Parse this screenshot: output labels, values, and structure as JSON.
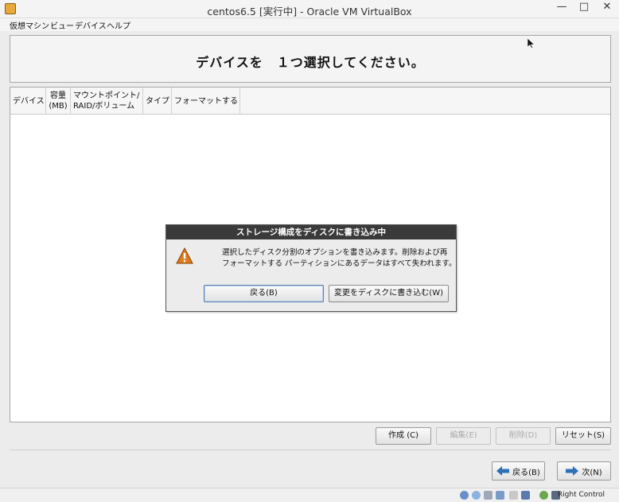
{
  "window": {
    "title": "centos6.5 [実行中] - Oracle VM VirtualBox",
    "min_glyph": "—",
    "max_glyph": "□",
    "close_glyph": "✕"
  },
  "menu": {
    "items": [
      "仮想マシン",
      "ビュー",
      "デバイス",
      "ヘルプ"
    ]
  },
  "header": {
    "title": "デバイスを　１つ選択してください。"
  },
  "table": {
    "columns": {
      "device": "デバイス",
      "size_1": "容量",
      "size_2": "(MB)",
      "mount_1": "マウントポイント/",
      "mount_2": "RAID/ボリューム",
      "type": "タイプ",
      "format": "フォーマットする"
    }
  },
  "dialog": {
    "title": "ストレージ構成をディスクに書き込み中",
    "message_line1": "選択したディスク分割のオプションを書き込みます。削除および再",
    "message_line2": "フォーマットする パーティションにあるデータはすべて失われます。",
    "back_label": "戻る(B)",
    "write_label": "変更をディスクに書き込む(W)"
  },
  "actions": {
    "create": "作成 (C)",
    "edit": "編集(E)",
    "delete": "削除(D)",
    "reset": "リセット(S)"
  },
  "nav": {
    "prev": "戻る(B)",
    "next": "次(N)"
  },
  "statusbar": {
    "host_key": "Right Control"
  },
  "colors": {
    "dialog_title_bg": "#3a3a3a",
    "warning": "#e07b1a",
    "nav_arrow": "#2f6fb5"
  }
}
